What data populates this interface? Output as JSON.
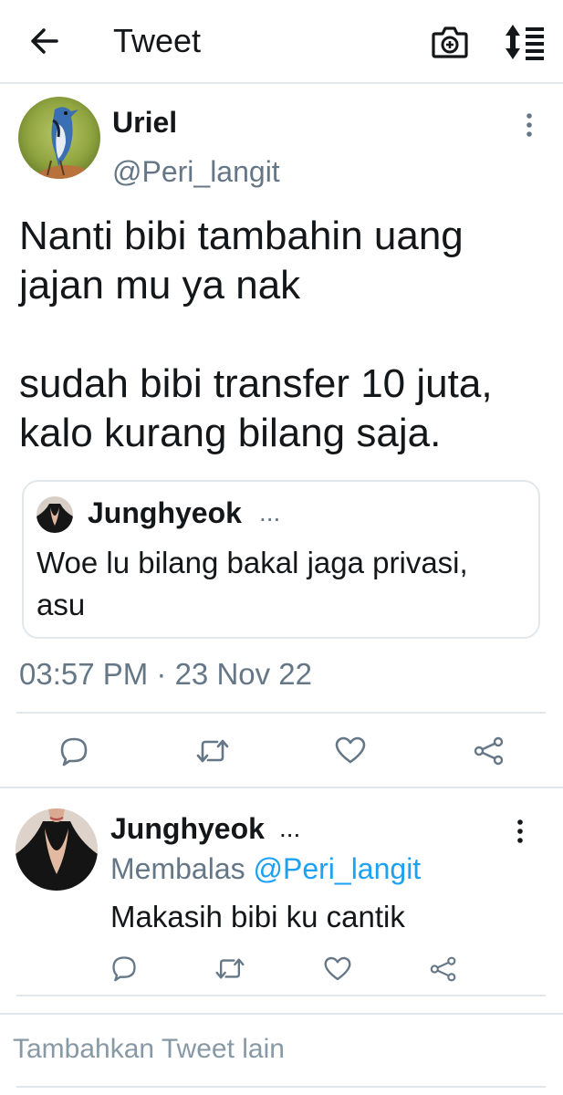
{
  "header": {
    "title": "Tweet",
    "back_icon": "arrow-left-icon",
    "camera_icon": "camera-plus-icon",
    "sort_icon": "sort-lines-icon"
  },
  "tweet": {
    "author_name": "Uriel",
    "author_handle": "@Peri_langit",
    "avatar": "blue-jay-bird-photo",
    "text_lines": [
      "Nanti bibi tambahin uang jajan mu ya nak",
      "sudah bibi transfer 10 juta, kalo kurang bilang saja."
    ],
    "quote": {
      "author_name": "Junghyeok",
      "ellipsis": "...",
      "text": "Woe lu bilang bakal jaga privasi, asu"
    },
    "timestamp": "03:57 PM · 23 Nov 22"
  },
  "reply": {
    "author_name": "Junghyeok",
    "ellipsis": "...",
    "replying_prefix": "Membalas",
    "replying_handle": "@Peri_langit",
    "text": "Makasih bibi ku cantik"
  },
  "compose": {
    "placeholder": "Tambahkan Tweet lain"
  },
  "colors": {
    "text": "#14171a",
    "secondary": "#657786",
    "link": "#1da1f2",
    "divider": "#e1e8ed"
  }
}
